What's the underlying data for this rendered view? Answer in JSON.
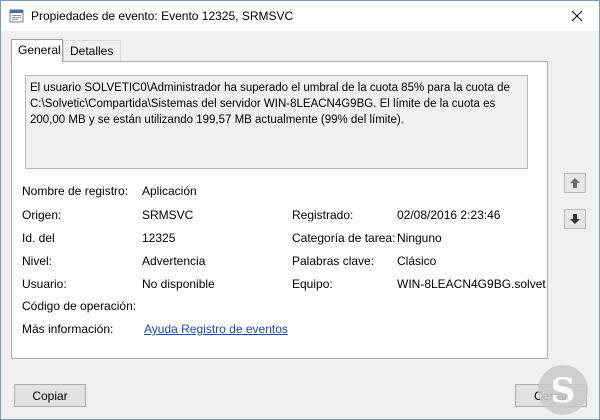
{
  "window": {
    "title": "Propiedades de evento: Evento 12325, SRMSVC"
  },
  "tabs": [
    {
      "label": "General",
      "active": true
    },
    {
      "label": "Detalles",
      "active": false
    }
  ],
  "description": "El usuario SOLVETIC0\\Administrador ha superado el umbral de la cuota 85% para la cuota de C:\\Solvetic\\Compartida\\Sistemas del servidor WIN-8LEACN4G9BG. El límite de la cuota es 200,00 MB y se están utilizando 199,57 MB actualmente (99% del límite).",
  "fields": {
    "log_name_label": "Nombre de registro:",
    "log_name_value": "Aplicación",
    "source_label": "Origen:",
    "source_value": "SRMSVC",
    "logged_label": "Registrado:",
    "logged_value": "02/08/2016 2:23:46",
    "event_id_label": "Id. del",
    "event_id_value": "12325",
    "task_category_label": "Categoría de tarea:",
    "task_category_value": "Ninguno",
    "level_label": "Nivel:",
    "level_value": "Advertencia",
    "keywords_label": "Palabras clave:",
    "keywords_value": "Clásico",
    "user_label": "Usuario:",
    "user_value": "No disponible",
    "computer_label": "Equipo:",
    "computer_value": "WIN-8LEACN4G9BG.solvet",
    "opcode_label": "Código de operación:",
    "more_info_label": "Más información:",
    "more_info_link": "Ayuda Registro de eventos"
  },
  "buttons": {
    "copy": "Copiar",
    "close": "Cerrar"
  },
  "icons": {
    "app": "event-viewer-icon",
    "close": "close-icon",
    "up": "arrow-up-icon",
    "down": "arrow-down-icon",
    "logo": "solvetic-logo-icon"
  },
  "colors": {
    "link": "#1a47c6",
    "window_border": "#7a9bc4",
    "logo": "#c9c9c9"
  }
}
